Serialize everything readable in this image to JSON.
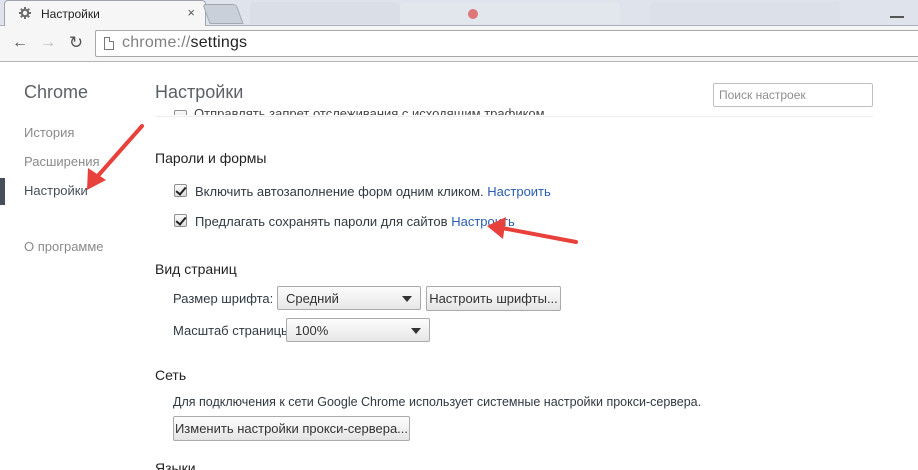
{
  "browser": {
    "active_tab": {
      "title": "Настройки",
      "icon": "gear-icon",
      "close": "×"
    },
    "omnibox": {
      "scheme": "chrome://",
      "path": "settings"
    }
  },
  "sidebar": {
    "brand": "Chrome",
    "items": [
      {
        "label": "История"
      },
      {
        "label": "Расширения"
      },
      {
        "label": "Настройки",
        "selected": true
      },
      {
        "label": "О программе"
      }
    ]
  },
  "main": {
    "title": "Настройки",
    "search_placeholder": "Поиск настроек",
    "cut_row_text": "Отправлять запрет отслеживания с исходящим трафиком",
    "passwords": {
      "title": "Пароли и формы",
      "autofill": {
        "label": "Включить автозаполнение форм одним кликом.",
        "link": "Настроить",
        "checked": true
      },
      "save_passwords": {
        "label": "Предлагать сохранять пароли для сайтов",
        "link": "Настроить",
        "checked": true
      }
    },
    "appearance": {
      "title": "Вид страниц",
      "font_size_label": "Размер шрифта:",
      "font_size_value": "Средний",
      "customize_fonts_button": "Настроить шрифты...",
      "zoom_label": "Масштаб страницы:",
      "zoom_value": "100%"
    },
    "network": {
      "title": "Сеть",
      "description": "Для подключения к сети Google Chrome использует системные настройки прокси-сервера.",
      "proxy_button": "Изменить настройки прокси-сервера..."
    },
    "languages": {
      "title": "Языки"
    }
  },
  "colors": {
    "annotation_arrow": "#e8403a",
    "link": "#2a5db0"
  }
}
